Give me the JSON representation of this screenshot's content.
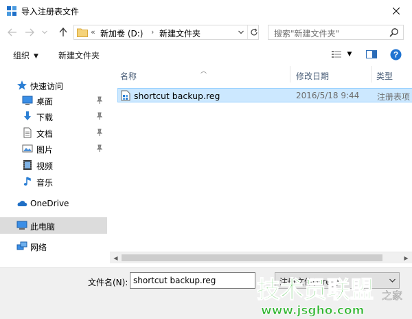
{
  "window": {
    "title": "导入注册表文件"
  },
  "address": {
    "overflow": "«",
    "crumbs": [
      "新加卷 (D:)",
      "新建文件夹"
    ],
    "separator": "›"
  },
  "search": {
    "placeholder": "搜索\"新建文件夹\""
  },
  "toolbar": {
    "organize_label": "组织",
    "new_folder_label": "新建文件夹"
  },
  "nav": {
    "quick_access": "快速访问",
    "items": [
      {
        "label": "桌面",
        "icon": "desktop-icon",
        "pinned": true
      },
      {
        "label": "下载",
        "icon": "download-icon",
        "pinned": true
      },
      {
        "label": "文档",
        "icon": "documents-icon",
        "pinned": true
      },
      {
        "label": "图片",
        "icon": "pictures-icon",
        "pinned": true
      },
      {
        "label": "视频",
        "icon": "videos-icon",
        "pinned": false
      },
      {
        "label": "音乐",
        "icon": "music-icon",
        "pinned": false
      }
    ],
    "onedrive": "OneDrive",
    "this_pc": "此电脑",
    "network": "网络"
  },
  "columns": {
    "name": "名称",
    "date": "修改日期",
    "type": "类型"
  },
  "files": [
    {
      "name": "shortcut backup.reg",
      "date": "2016/5/18 9:44",
      "type": "注册表项"
    }
  ],
  "footer": {
    "filename_label": "文件名(N):",
    "filename_value": "shortcut backup.reg",
    "filetype_value": "注册文件(*.reg)"
  },
  "watermark": {
    "brand": "技术员联盟",
    "url": "www.jsgho.com",
    "suffix": "之家"
  },
  "colors": {
    "selection_bg": "#cce8ff",
    "selection_border": "#99d1ff",
    "accent": "#0078d7",
    "header_text": "#4c607a",
    "watermark_green": "#2fb52f"
  }
}
